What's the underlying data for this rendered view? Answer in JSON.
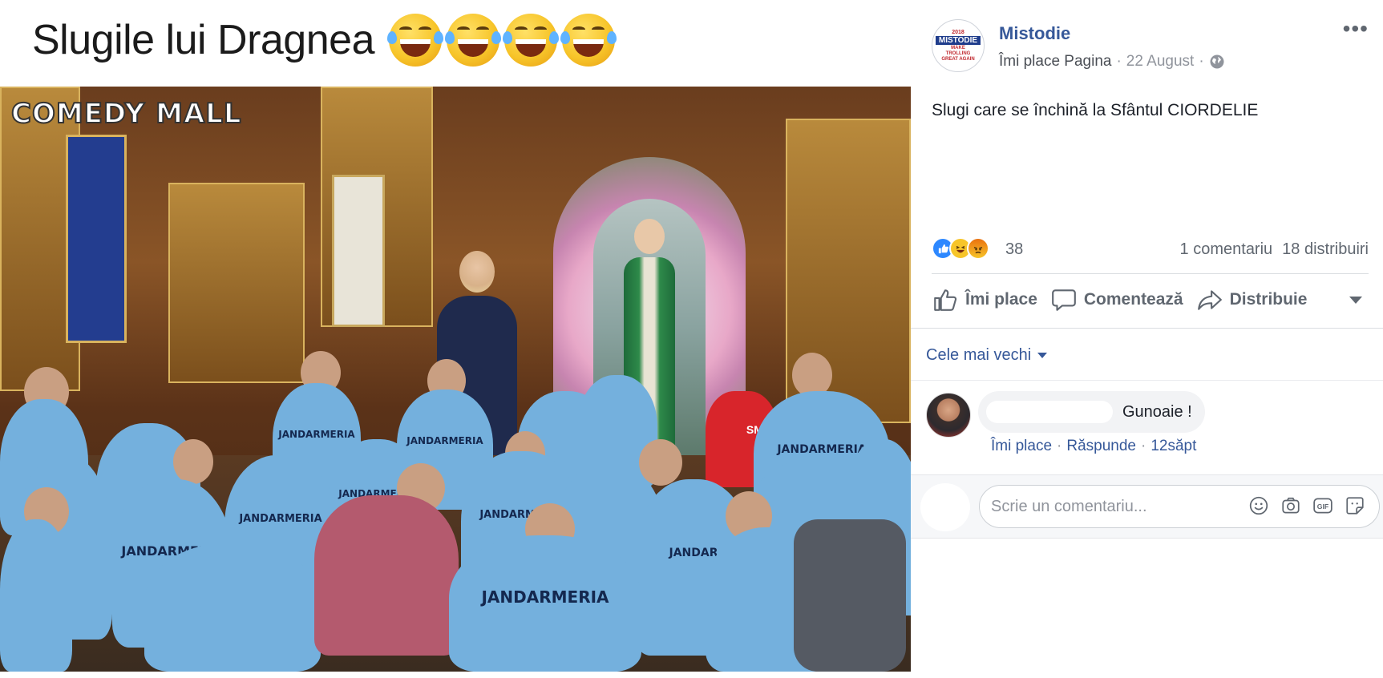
{
  "post": {
    "caption": "Slugile lui Dragnea",
    "caption_emojis": [
      "face-with-tears-of-joy",
      "face-with-tears-of-joy",
      "face-with-tears-of-joy",
      "face-with-tears-of-joy"
    ],
    "image": {
      "watermark": "COMEDY MALL",
      "shirt_text": "JANDARMERIA",
      "shirt_text_partial": "JANDAR",
      "shirt_badge_text": "SMU"
    }
  },
  "page": {
    "name": "Mistodie",
    "logo": {
      "year": "2018",
      "name": "MISTODIE",
      "tagline": "MAKE TROLLING GREAT AGAIN"
    },
    "like_page_label": "Îmi place Pagina",
    "separator": "·",
    "date": "22 August",
    "audience_icon": "globe-icon",
    "more_icon": "more-options-icon"
  },
  "post_text": "Slugi care se închină la Sfântul CIORDELIE",
  "reactions": {
    "types": [
      "like",
      "haha",
      "angry"
    ],
    "count": "38",
    "comments_label": "1 comentariu",
    "shares_label": "18 distribuiri"
  },
  "actions": {
    "like": "Îmi place",
    "comment": "Comentează",
    "share": "Distribuie"
  },
  "comments_sort": {
    "label": "Cele mai vechi"
  },
  "comments": [
    {
      "text": "Gunoaie !",
      "like_label": "Îmi place",
      "reply_label": "Răspunde",
      "time": "12săpt"
    }
  ],
  "composer": {
    "placeholder": "Scrie un comentariu...",
    "icons": [
      "emoji-icon",
      "camera-icon",
      "gif-icon",
      "sticker-icon"
    ]
  },
  "colors": {
    "link": "#365899",
    "muted": "#90949c",
    "like_blue": "#2d88ff",
    "jandarmeria_shirt": "#74b0dd"
  }
}
